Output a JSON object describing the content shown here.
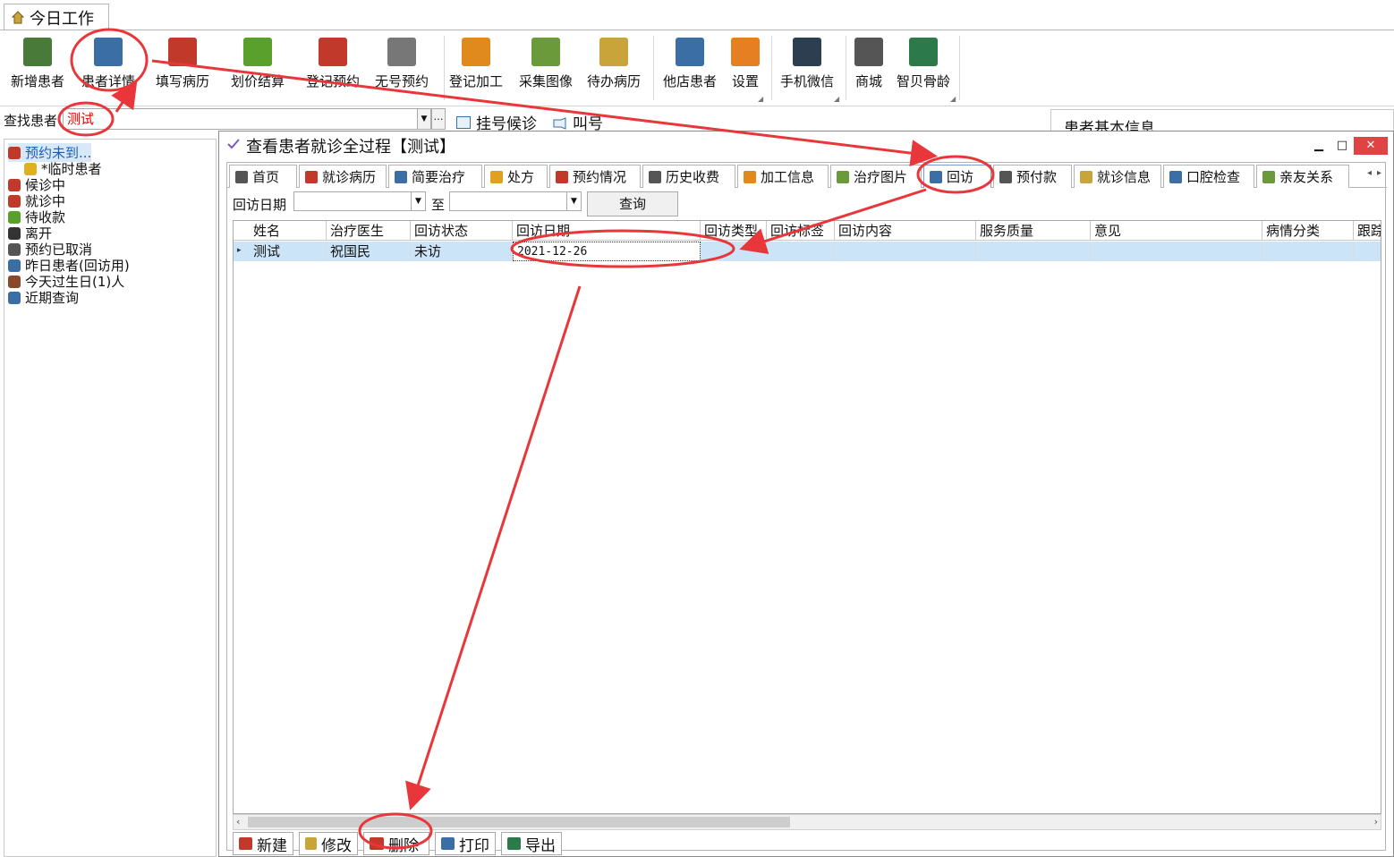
{
  "app": {
    "title": "今日工作"
  },
  "ribbon": {
    "buttons": [
      {
        "label": "新增患者",
        "icon": "add-patient-icon",
        "color": "#4a7a3a"
      },
      {
        "label": "患者详情",
        "icon": "patient-detail-icon",
        "color": "#3a6ea5"
      },
      {
        "label": "填写病历",
        "icon": "medical-record-icon",
        "color": "#c0392b"
      },
      {
        "label": "划价结算",
        "icon": "yen-icon",
        "color": "#5aa02c"
      },
      {
        "label": "登记预约",
        "icon": "calendar-icon",
        "color": "#c0392b"
      },
      {
        "label": "无号预约",
        "icon": "calendar-grid-icon",
        "color": "#777777"
      },
      {
        "label": "登记加工",
        "icon": "cubes-icon",
        "color": "#e08a1e"
      },
      {
        "label": "采集图像",
        "icon": "image-icon",
        "color": "#6a9a3a"
      },
      {
        "label": "待办病历",
        "icon": "clipboard-check-icon",
        "color": "#c9a43a"
      },
      {
        "label": "他店患者",
        "icon": "other-store-icon",
        "color": "#3a6ea5"
      },
      {
        "label": "设置",
        "icon": "rss-settings-icon",
        "color": "#e67e22"
      },
      {
        "label": "手机微信",
        "icon": "phone-icon",
        "color": "#2c3e50"
      },
      {
        "label": "商城",
        "icon": "cart-icon",
        "color": "#555555"
      },
      {
        "label": "智贝骨龄",
        "icon": "antenna-icon",
        "color": "#2c7a4a"
      }
    ]
  },
  "search": {
    "label": "查找患者",
    "value": "测试",
    "register_label": "挂号候诊",
    "call_label": "叫号"
  },
  "right_panel": {
    "title": "患者基本信息"
  },
  "tree": {
    "items": [
      {
        "label": "预约未到...",
        "icon": "appointment-icon",
        "color": "#c0392b"
      },
      {
        "label": "*临时患者",
        "icon": "temp-patient-icon",
        "color": "#e0b020"
      },
      {
        "label": "候诊中",
        "icon": "waiting-icon",
        "color": "#c0392b"
      },
      {
        "label": "就诊中",
        "icon": "in-treatment-icon",
        "color": "#c0392b"
      },
      {
        "label": "待收款",
        "icon": "yen-small-icon",
        "color": "#5aa02c"
      },
      {
        "label": "离开",
        "icon": "walk-icon",
        "color": "#333333"
      },
      {
        "label": "预约已取消",
        "icon": "calendar-cancel-icon",
        "color": "#555555"
      },
      {
        "label": "昨日患者(回访用)",
        "icon": "revisit-icon",
        "color": "#3a6ea5"
      },
      {
        "label": "今天过生日(1)人",
        "icon": "cake-icon",
        "color": "#8a4a2a"
      },
      {
        "label": "近期查询",
        "icon": "query-icon",
        "color": "#3a6ea5"
      }
    ]
  },
  "dialog": {
    "title": "查看患者就诊全过程【测试】",
    "minimize": "▁",
    "maximize": "□",
    "close": "✕"
  },
  "tabs": [
    {
      "label": "首页",
      "icon": "home-tab-icon",
      "color": "#555555"
    },
    {
      "label": "就诊病历",
      "icon": "record-tab-icon",
      "color": "#c0392b"
    },
    {
      "label": "简要治疗",
      "icon": "brief-tab-icon",
      "color": "#3a6ea5"
    },
    {
      "label": "处方",
      "icon": "pill-tab-icon",
      "color": "#e0a020"
    },
    {
      "label": "预约情况",
      "icon": "appointment-tab-icon",
      "color": "#c0392b"
    },
    {
      "label": "历史收费",
      "icon": "fee-tab-icon",
      "color": "#555555"
    },
    {
      "label": "加工信息",
      "icon": "process-tab-icon",
      "color": "#e08a1e"
    },
    {
      "label": "治疗图片",
      "icon": "picture-tab-icon",
      "color": "#6a9a3a"
    },
    {
      "label": "回访",
      "icon": "revisit-tab-icon",
      "color": "#3a6ea5"
    },
    {
      "label": "预付款",
      "icon": "prepay-tab-icon",
      "color": "#555555"
    },
    {
      "label": "就诊信息",
      "icon": "visit-info-tab-icon",
      "color": "#c9a43a"
    },
    {
      "label": "口腔检查",
      "icon": "oral-exam-tab-icon",
      "color": "#3a6ea5"
    },
    {
      "label": "亲友关系",
      "icon": "relatives-tab-icon",
      "color": "#6a9a3a"
    }
  ],
  "filter": {
    "date_label": "回访日期",
    "to_label": "至",
    "query_label": "查询"
  },
  "grid": {
    "headers": [
      "姓名",
      "治疗医生",
      "回访状态",
      "回访日期",
      "回访类型",
      "回访标签",
      "回访内容",
      "服务质量",
      "意见",
      "病情分类",
      "跟踪"
    ],
    "rows": [
      [
        "测试",
        "祝国民",
        "未访",
        "2021-12-26",
        "",
        "",
        "",
        "",
        "",
        "",
        ""
      ]
    ]
  },
  "bottom_buttons": [
    {
      "label": "新建",
      "icon": "phone-new-icon",
      "color": "#c0392b"
    },
    {
      "label": "修改",
      "icon": "edit-icon",
      "color": "#c9a43a"
    },
    {
      "label": "删除",
      "icon": "delete-icon",
      "color": "#c0392b"
    },
    {
      "label": "打印",
      "icon": "print-icon",
      "color": "#3a6ea5"
    },
    {
      "label": "导出",
      "icon": "export-icon",
      "color": "#2c7a4a"
    }
  ],
  "annotation_color": "#e8363a"
}
